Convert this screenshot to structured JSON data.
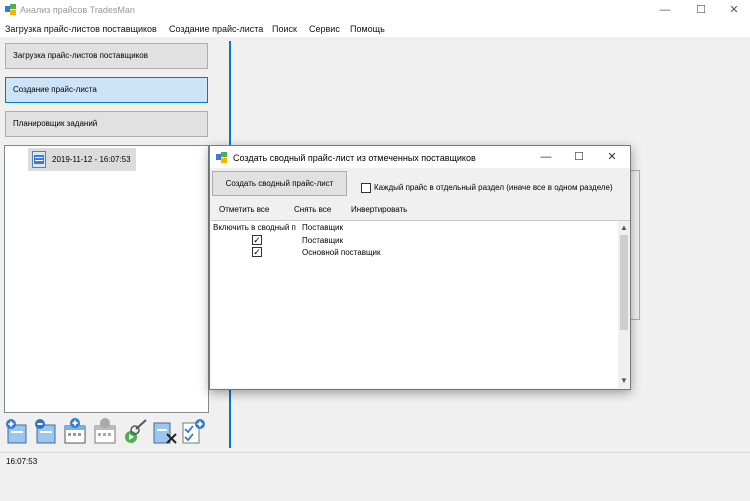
{
  "window": {
    "title": "Анализ прайсов TradesMan",
    "minimize": "—",
    "maximize": "☐",
    "close": "✕"
  },
  "menu": [
    "Загрузка прайс-листов поставщиков",
    "Создание прайс-листа",
    "Поиск",
    "Сервис",
    "Помощь"
  ],
  "nav": {
    "load_label": "Загрузка прайс-листов поставщиков",
    "create_label": "Создание прайс-листа",
    "scheduler_label": "Планировщик заданий"
  },
  "tree": {
    "item_label": "2019-11-12 - 16:07:53"
  },
  "status": {
    "text": "16:07:53"
  },
  "dialog": {
    "title": "Создать сводный прайс-лист из отмеченных поставщиков",
    "minimize": "—",
    "maximize": "☐",
    "close": "✕",
    "create_button": "Создать сводный прайс-лист",
    "separate_section_label": "Каждый прайс в отдельный раздел (иначе все в одном разделе)",
    "separate_section_checked": false,
    "select_all": "Отметить все",
    "deselect_all": "Снять все",
    "invert": "Инвертировать",
    "columns": [
      "Включить в сводный п",
      "Поставщик"
    ],
    "rows": [
      {
        "include": true,
        "supplier": "Поставщик"
      },
      {
        "include": true,
        "supplier": "Основной поставщик"
      }
    ]
  },
  "icons": [
    "app-icon",
    "document-icon",
    "add-price-icon",
    "refresh-price-icon",
    "calendar-add-icon",
    "calendar-icon",
    "search-next-icon",
    "delete-price-icon",
    "check-all-icon"
  ],
  "colors": {
    "accent": "#0078d7",
    "active_nav_bg": "#cce4f7",
    "button_bg": "#e1e1e1"
  }
}
